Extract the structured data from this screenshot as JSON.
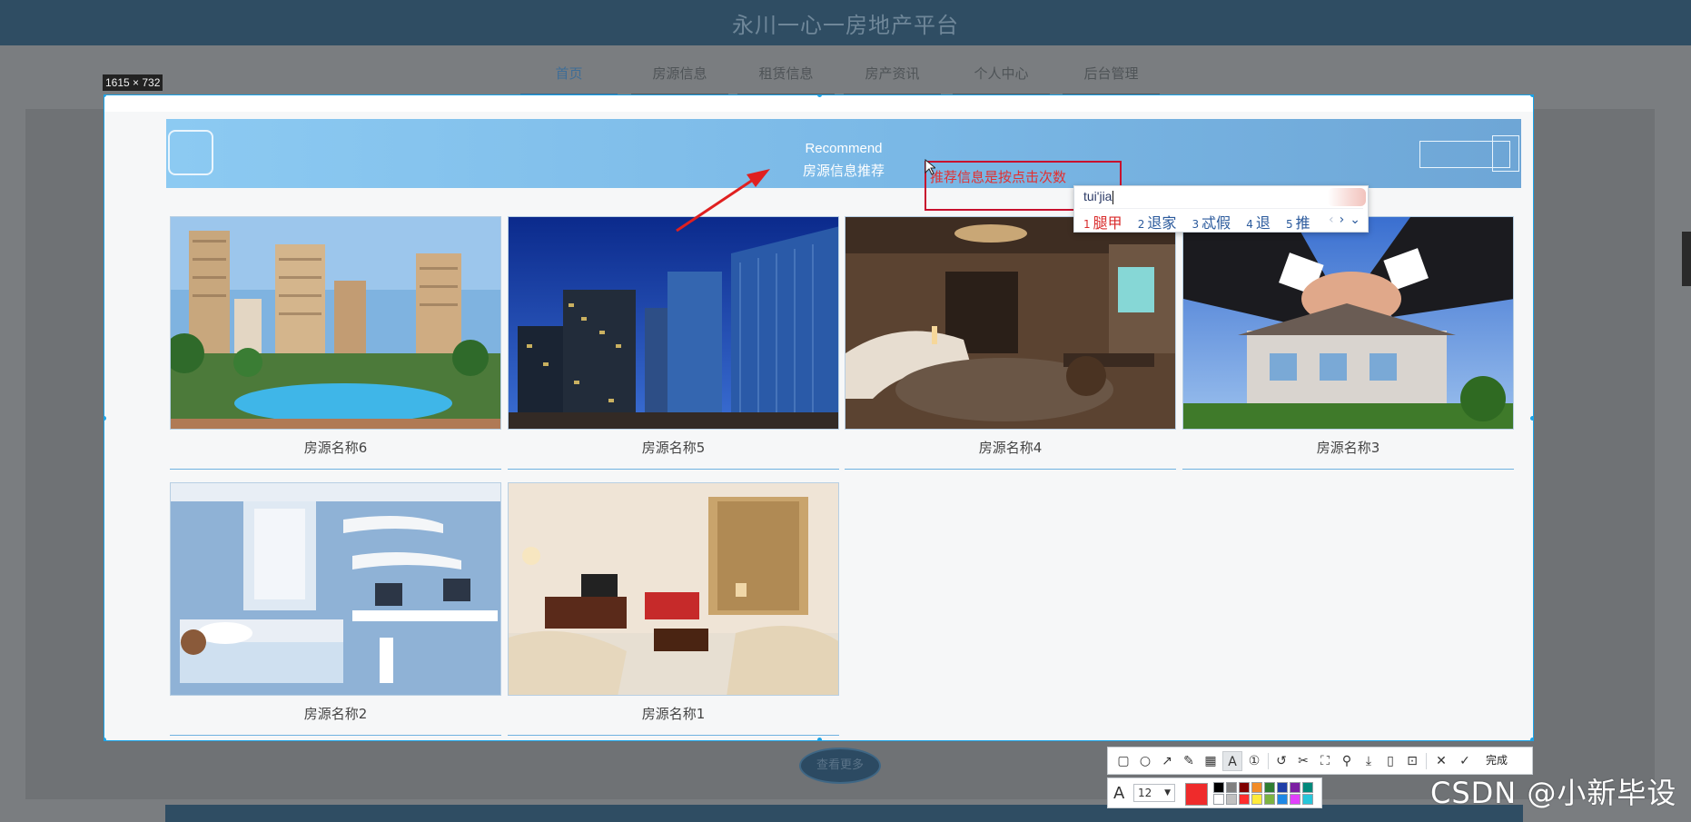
{
  "site": {
    "title": "永川一心一房地产平台",
    "nav": [
      {
        "label": "首页",
        "active": true
      },
      {
        "label": "房源信息",
        "active": false
      },
      {
        "label": "租赁信息",
        "active": false
      },
      {
        "label": "房产资讯",
        "active": false
      },
      {
        "label": "个人中心",
        "active": false
      },
      {
        "label": "后台管理",
        "active": false
      }
    ],
    "more_button": "查看更多"
  },
  "capture": {
    "dimension_label": "1615 × 732"
  },
  "recommend": {
    "title_en": "Recommend",
    "title_cn": "房源信息推荐",
    "cards": [
      {
        "name": "房源名称6",
        "image": "residential-towers-with-pool"
      },
      {
        "name": "房源名称5",
        "image": "glass-office-towers-blue-sky"
      },
      {
        "name": "房源名称4",
        "image": "hotel-lounge-interior"
      },
      {
        "name": "房源名称3",
        "image": "handshake-over-villa"
      },
      {
        "name": "房源名称2",
        "image": "blue-kids-bedroom"
      },
      {
        "name": "房源名称1",
        "image": "beige-living-room"
      }
    ]
  },
  "annotation": {
    "text": "推荐信息是按点击次数",
    "color": "#e23030"
  },
  "ime": {
    "input": "tui'jia",
    "candidates": [
      {
        "index": "1",
        "text": "腿甲"
      },
      {
        "index": "2",
        "text": "退家"
      },
      {
        "index": "3",
        "text": "忒假"
      },
      {
        "index": "4",
        "text": "退"
      },
      {
        "index": "5",
        "text": "推"
      }
    ]
  },
  "toolbar": {
    "tools": [
      "rectangle-icon",
      "ellipse-icon",
      "arrow-icon",
      "pen-icon",
      "mosaic-icon",
      "text-icon",
      "number-icon",
      "undo-icon",
      "cut-icon",
      "ocr-icon",
      "pin-icon",
      "save-icon",
      "copy-icon",
      "bookmark-icon",
      "close-icon"
    ],
    "done_label": "完成",
    "font_size": "12",
    "current_color": "#ef2b2b",
    "palette_top": [
      "#000000",
      "#808080",
      "#800000",
      "#f28c28",
      "#2e7d32",
      "#1f3fa8",
      "#7b1fa2",
      "#00897b"
    ],
    "palette_bottom": [
      "#ffffff",
      "#c0c0c0",
      "#ff2d2d",
      "#ffeb3b",
      "#7cb342",
      "#1e88e5",
      "#e040fb",
      "#26c6da"
    ]
  },
  "watermark": "CSDN @小新毕设"
}
